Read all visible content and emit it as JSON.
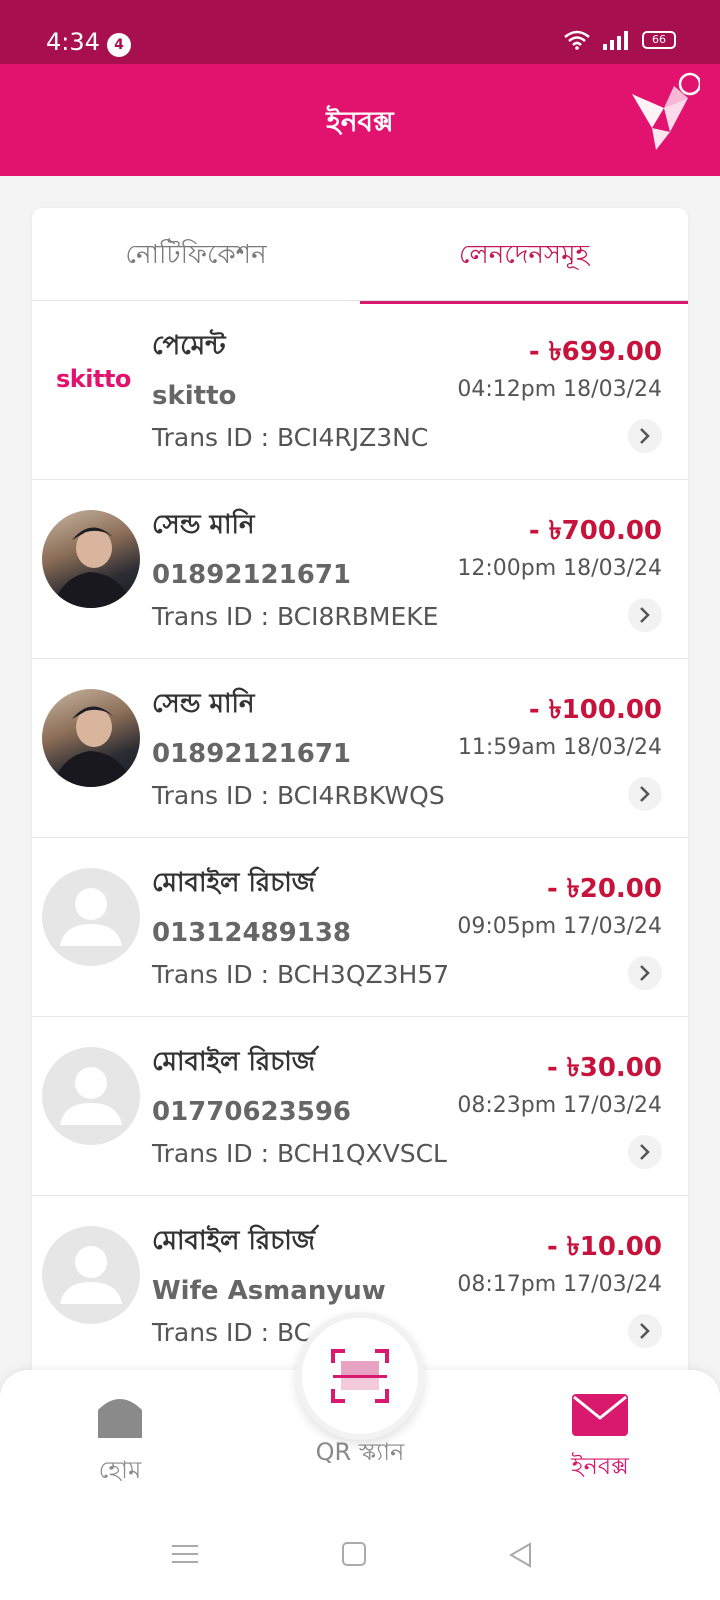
{
  "status": {
    "time": "4:34",
    "notif_count": "4",
    "battery": "66"
  },
  "appbar": {
    "title": "ইনবক্স"
  },
  "tabs": [
    {
      "label": "নোটিফিকেশন",
      "active": false
    },
    {
      "label": "লেনদেনসমূহ",
      "active": true
    }
  ],
  "transactions": [
    {
      "title": "পেমেন্ট",
      "subtitle": "skitto",
      "trans_id": "Trans ID : BCI4RJZ3NC",
      "amount": "- ৳699.00",
      "time": "04:12pm 18/03/24",
      "avatar": "skitto-logo",
      "logo_text": "skitto"
    },
    {
      "title": "সেন্ড মানি",
      "subtitle": "01892121671",
      "trans_id": "Trans ID : BCI8RBMEKE",
      "amount": "- ৳700.00",
      "time": "12:00pm 18/03/24",
      "avatar": "photo"
    },
    {
      "title": "সেন্ড মানি",
      "subtitle": "01892121671",
      "trans_id": "Trans ID : BCI4RBKWQS",
      "amount": "- ৳100.00",
      "time": "11:59am 18/03/24",
      "avatar": "photo"
    },
    {
      "title": "মোবাইল রিচার্জ",
      "subtitle": "01312489138",
      "trans_id": "Trans ID : BCH3QZ3H57",
      "amount": "- ৳20.00",
      "time": "09:05pm 17/03/24",
      "avatar": "placeholder"
    },
    {
      "title": "মোবাইল রিচার্জ",
      "subtitle": "01770623596",
      "trans_id": "Trans ID : BCH1QXVSCL",
      "amount": "- ৳30.00",
      "time": "08:23pm 17/03/24",
      "avatar": "placeholder"
    },
    {
      "title": "মোবাইল রিচার্জ",
      "subtitle": "Wife Asmanyuw",
      "trans_id": "Trans ID : BC",
      "amount": "- ৳10.00",
      "time": "08:17pm 17/03/24",
      "avatar": "placeholder"
    }
  ],
  "bottom_nav": [
    {
      "label": "হোম",
      "icon": "home-icon",
      "active": false
    },
    {
      "label": "QR স্ক্যান",
      "icon": "qr-scan-icon",
      "active": false
    },
    {
      "label": "ইনবক্স",
      "icon": "mail-icon",
      "active": true
    }
  ],
  "colors": {
    "brand": "#e2136e",
    "status_bar": "#a80f4e",
    "amount": "#c7133c"
  }
}
